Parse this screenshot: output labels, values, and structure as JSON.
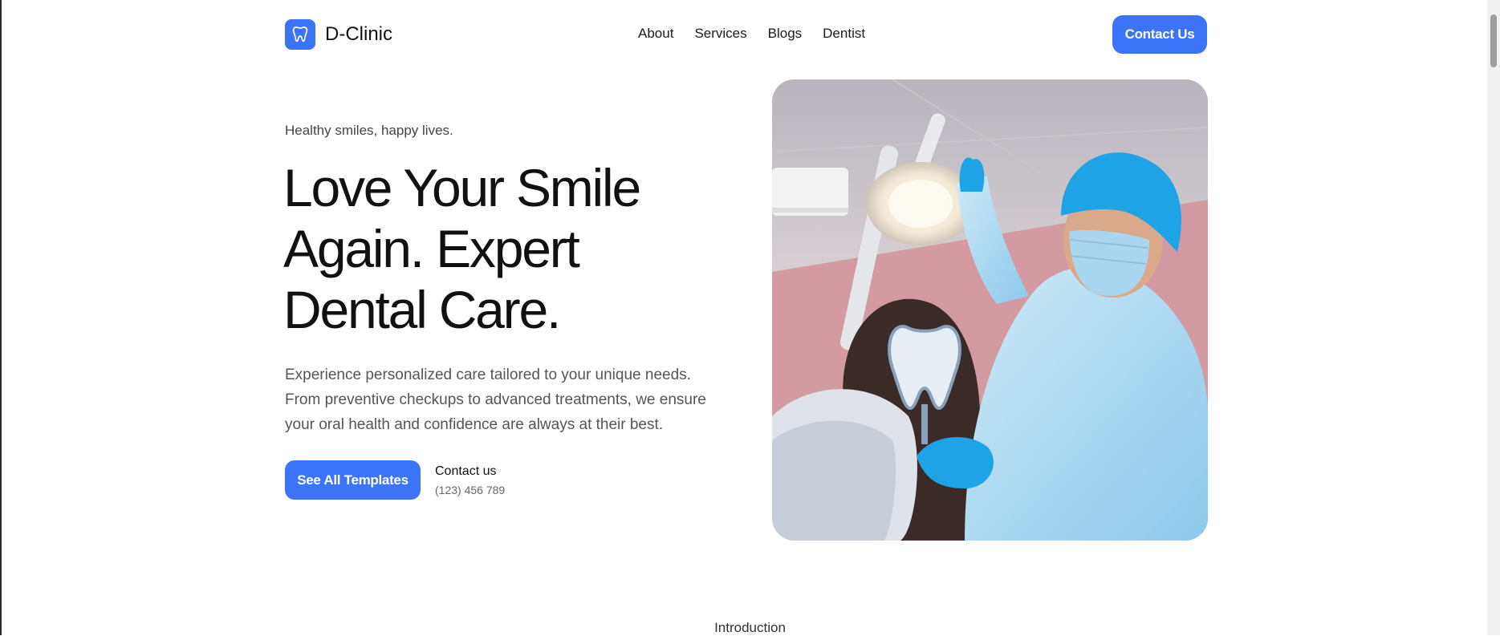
{
  "header": {
    "brand_name": "D-Clinic",
    "logo_icon": "tooth-icon",
    "nav": [
      "About",
      "Services",
      "Blogs",
      "Dentist"
    ],
    "contact_button": "Contact Us"
  },
  "hero": {
    "tagline": "Healthy smiles, happy lives.",
    "title": "Love Your Smile Again. Expert Dental Care.",
    "description": "Experience personalized care tailored to your unique needs. From preventive checkups to advanced treatments, we ensure your oral health and confidence are always at their best.",
    "cta_button": "See All Templates",
    "contact_label": "Contact us",
    "contact_phone": "(123) 456 789"
  },
  "intro": {
    "label": "Introduction"
  },
  "colors": {
    "accent": "#3b74f7",
    "text": "#111111",
    "muted": "#555555"
  }
}
